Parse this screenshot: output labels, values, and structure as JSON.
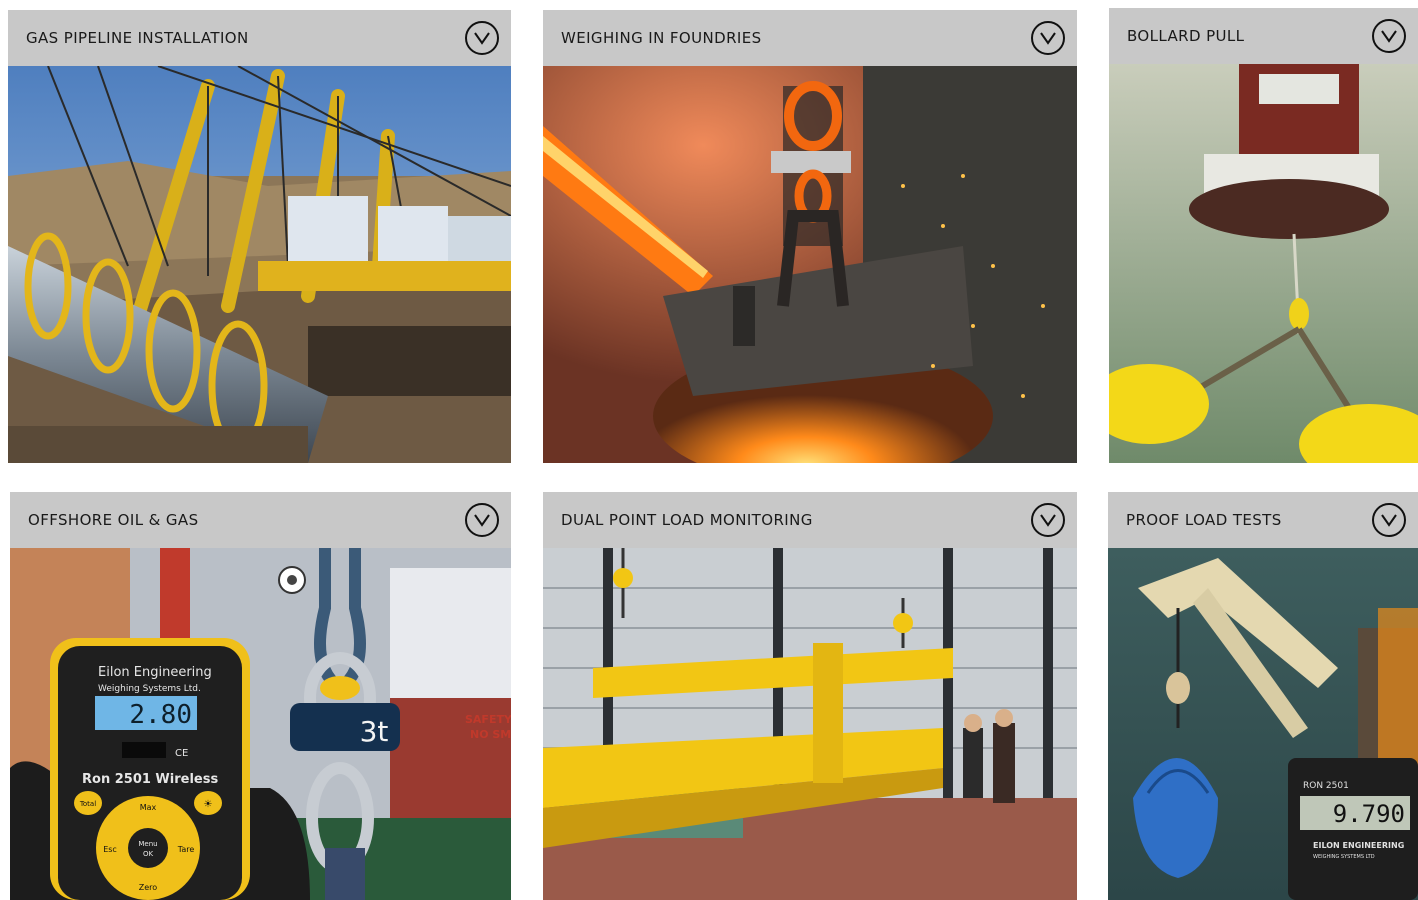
{
  "cards": [
    {
      "title": "GAS PIPELINE INSTALLATION"
    },
    {
      "title": "WEIGHING IN FOUNDRIES"
    },
    {
      "title": "BOLLARD PULL"
    },
    {
      "title": "OFFSHORE OIL & GAS"
    },
    {
      "title": "DUAL POINT LOAD MONITORING"
    },
    {
      "title": "PROOF LOAD TESTS"
    }
  ],
  "device": {
    "brand": "Eilon Engineering",
    "brand_sub": "Weighing Systems Ltd.",
    "reading": "2.80",
    "ce_mark": "CE",
    "model": "Ron 2501 Wireless",
    "btn_total": "Total",
    "btn_max": "Max",
    "btn_esc": "Esc",
    "btn_menu": "Menu",
    "btn_ok": "OK",
    "btn_tare": "Tare",
    "btn_zero": "Zero",
    "shackle_capacity": "3t",
    "sign_text_1": "SAFETY",
    "sign_text_2": "NO SM"
  },
  "proof": {
    "display_model": "RON 2501",
    "reading": "9.790",
    "brand": "EILON ENGINEERING",
    "brand_sub": "WEIGHING SYSTEMS LTD"
  },
  "colors": {
    "header_bg": "#c8c8c8",
    "title_text": "#1a1a1a",
    "accent_yellow": "#f2c614"
  },
  "icons": {
    "expand": "chevron-down-circle-icon"
  }
}
